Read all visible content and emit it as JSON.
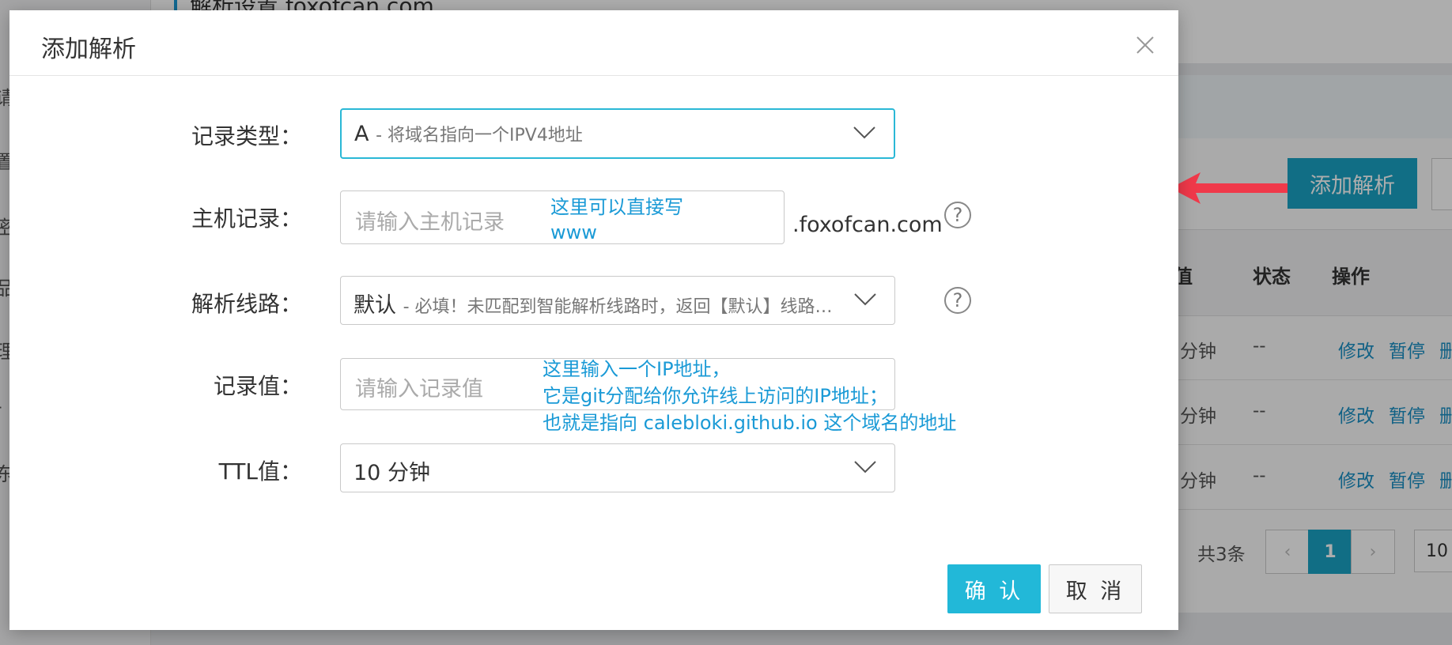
{
  "background": {
    "page_title": "解析设置 foxofcan.com",
    "add_button": "添加解析",
    "table_headers": [
      "值",
      "状态",
      "操作"
    ],
    "rows": [
      {
        "ttl": "分钟",
        "status": "--",
        "actions": [
          "修改",
          "暂停",
          "删"
        ]
      },
      {
        "ttl": "分钟",
        "status": "--",
        "actions": [
          "修改",
          "暂停",
          "删"
        ]
      },
      {
        "ttl": "分钟",
        "status": "--",
        "actions": [
          "修改",
          "暂停",
          "删"
        ]
      }
    ],
    "total": "共3条",
    "current_page": "1",
    "page_size": "10",
    "pager_prev": "‹",
    "pager_next": "›",
    "sidebar_fragments": [
      "请",
      "置",
      "密",
      "品",
      "理",
      "-",
      "东"
    ]
  },
  "modal": {
    "title": "添加解析",
    "close_icon": "close-icon",
    "record_type": {
      "label": "记录类型：",
      "value": "A",
      "description": "- 将域名指向一个IPV4地址"
    },
    "host": {
      "label": "主机记录：",
      "placeholder": "请输入主机记录",
      "suffix": ".foxofcan.com"
    },
    "line": {
      "label": "解析线路：",
      "value": "默认",
      "description": "- 必填！未匹配到智能解析线路时，返回【默认】线路…"
    },
    "record_value": {
      "label": "记录值：",
      "placeholder": "请输入记录值"
    },
    "ttl": {
      "label": "TTL值：",
      "value": "10 分钟"
    },
    "confirm_label": "确 认",
    "cancel_label": "取 消",
    "help_glyph": "?"
  },
  "annotations": {
    "host_note_line1": "这里可以直接写",
    "host_note_line2": "www",
    "value_note_line1": "这里输入一个IP地址，",
    "value_note_line2": "它是git分配给你允许线上访问的IP地址；",
    "value_note_line3": "也就是指向 calebloki.github.io 这个域名的地址"
  },
  "colors": {
    "accent": "#22b8d8",
    "annotation": "#1a9ad6",
    "arrow": "#f0394a"
  }
}
